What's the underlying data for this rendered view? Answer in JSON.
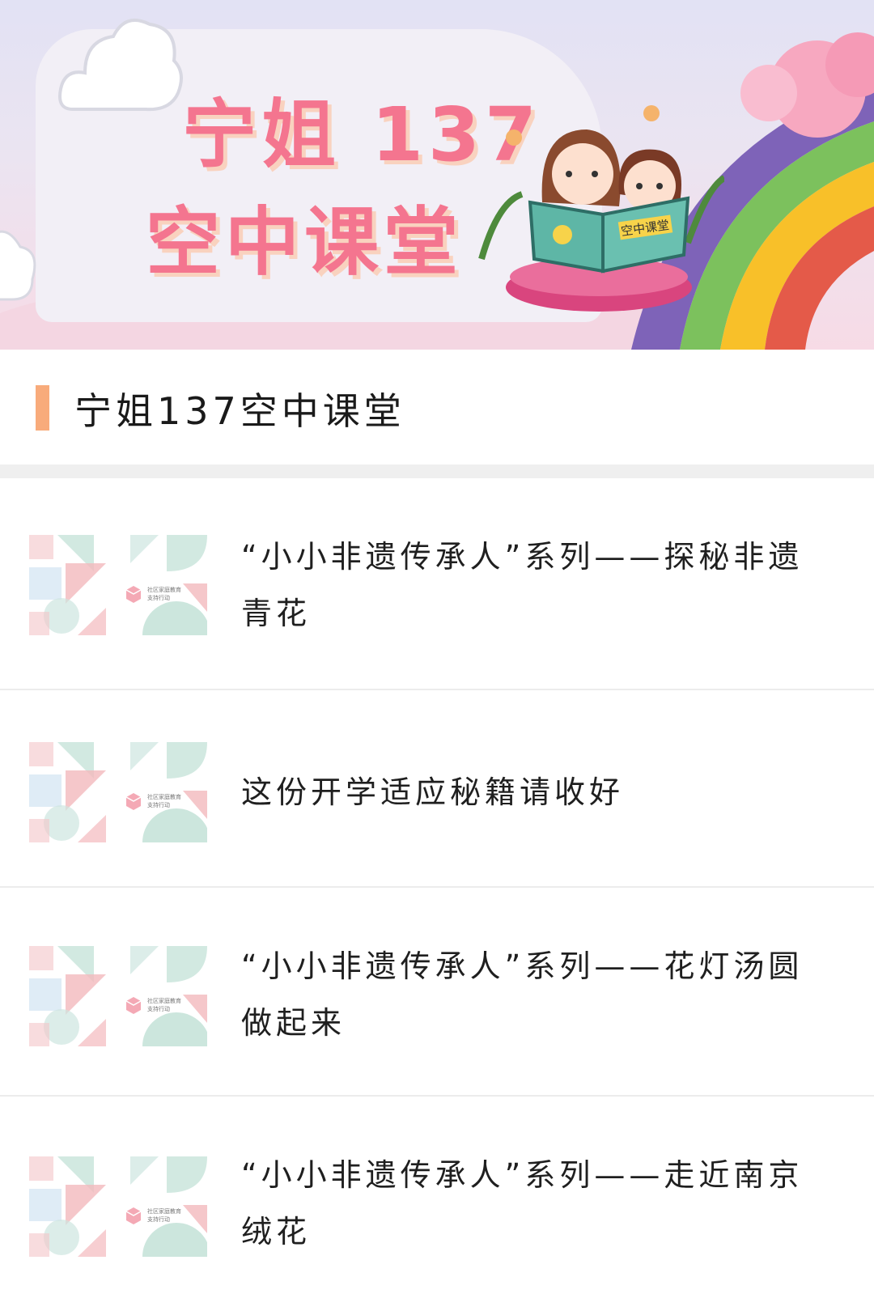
{
  "banner": {
    "title_line1": "宁姐 137",
    "title_line2": "空中课堂",
    "book_label": "空中课堂"
  },
  "section": {
    "title": "宁姐137空中课堂"
  },
  "thumbnail": {
    "caption_line1": "社区家庭教育",
    "caption_line2": "支持行动"
  },
  "articles": [
    {
      "title": "“小小非遗传承人”系列——探秘非遗青花"
    },
    {
      "title": "这份开学适应秘籍请收好"
    },
    {
      "title": "“小小非遗传承人”系列——花灯汤圆做起来"
    },
    {
      "title": "“小小非遗传承人”系列——走近南京绒花"
    }
  ]
}
